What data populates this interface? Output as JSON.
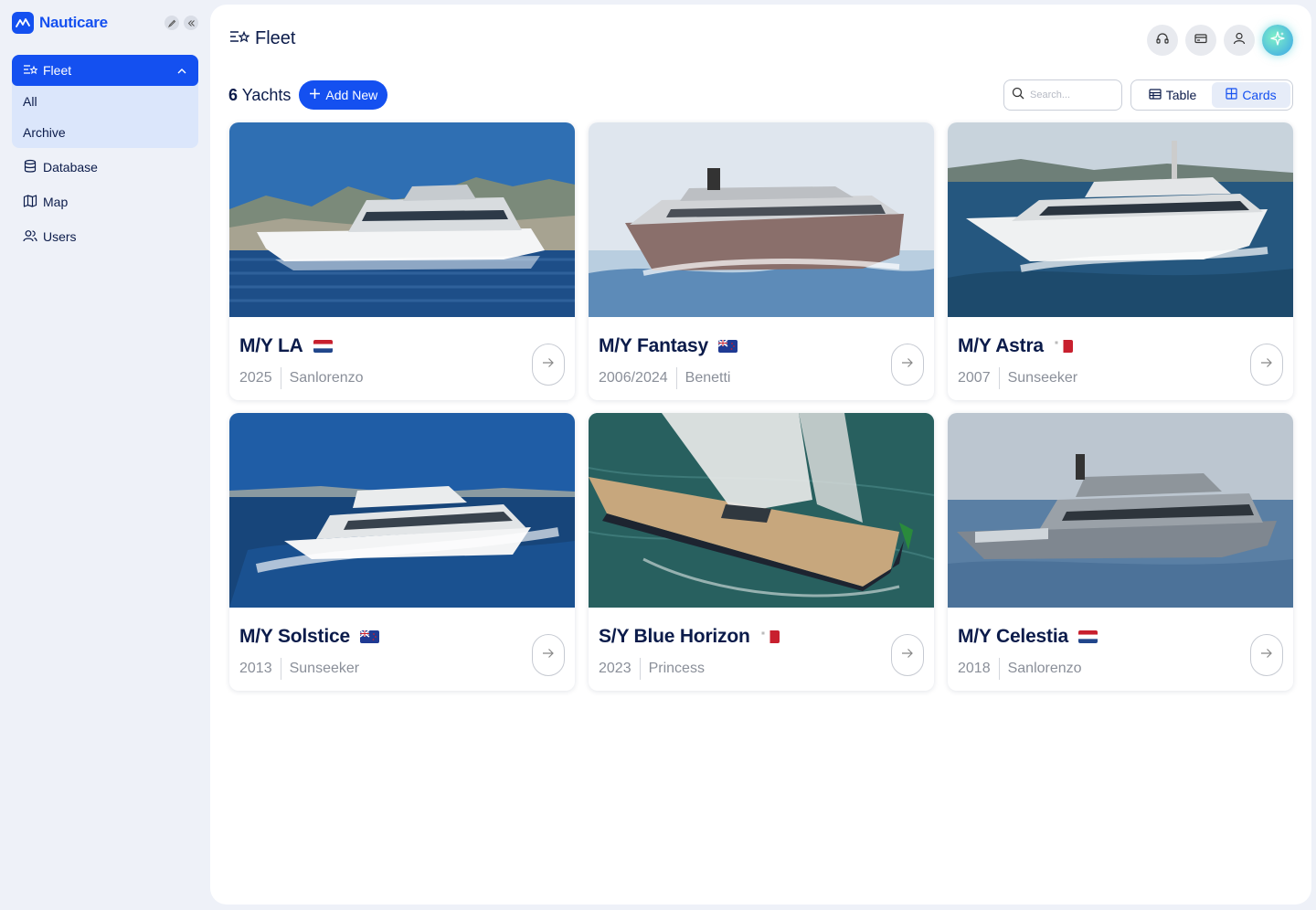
{
  "brand": {
    "name": "Nauticare"
  },
  "sidebar": {
    "fleet_label": "Fleet",
    "fleet_sub": [
      {
        "label": "All"
      },
      {
        "label": "Archive"
      }
    ],
    "items": [
      {
        "label": "Database",
        "icon": "database-icon"
      },
      {
        "label": "Map",
        "icon": "map-icon"
      },
      {
        "label": "Users",
        "icon": "users-icon"
      }
    ]
  },
  "header": {
    "title": "Fleet",
    "actions": [
      "headset-icon",
      "card-icon",
      "user-icon",
      "sparkle-icon"
    ]
  },
  "toolbar": {
    "count": "6",
    "count_label": "Yachts",
    "add_label": "Add New",
    "search_placeholder": "Search...",
    "view_table": "Table",
    "view_cards": "Cards",
    "active_view": "Cards"
  },
  "colors": {
    "accent": "#1450f0",
    "navy": "#0b1b4a",
    "muted": "#8a8f99"
  },
  "yachts": [
    {
      "name": "M/Y LA",
      "flag": "netherlands",
      "year": "2025",
      "builder": "Sanlorenzo"
    },
    {
      "name": "M/Y Fantasy",
      "flag": "new-zealand",
      "year": "2006/2024",
      "builder": "Benetti"
    },
    {
      "name": "M/Y Astra",
      "flag": "malta",
      "year": "2007",
      "builder": "Sunseeker"
    },
    {
      "name": "M/Y Solstice",
      "flag": "new-zealand",
      "year": "2013",
      "builder": "Sunseeker"
    },
    {
      "name": "S/Y Blue Horizon",
      "flag": "malta",
      "year": "2023",
      "builder": "Princess"
    },
    {
      "name": "M/Y Celestia",
      "flag": "netherlands",
      "year": "2018",
      "builder": "Sanlorenzo"
    }
  ]
}
